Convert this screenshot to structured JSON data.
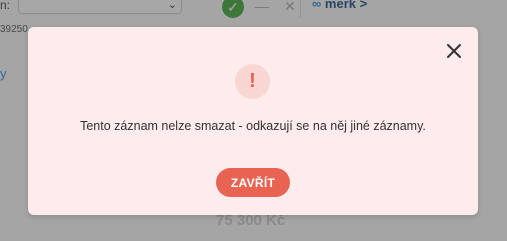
{
  "background": {
    "field_label": "n:",
    "number_fragment": "39250",
    "merk_label": "merk",
    "merk_arrow": ">",
    "side_letter": "y",
    "price": "75 300 Kč",
    "check_icon": "check-icon",
    "minus_icon": "minus-icon",
    "x_icon": "close-icon"
  },
  "dialog": {
    "icon": "warning-icon",
    "icon_glyph": "!",
    "message": "Tento záznam nelze smazat - odkazují se na něj jiné záznamy.",
    "close_button_label": "ZAVŘÍT",
    "accent_color": "#e96353",
    "background_color": "#fdeceb"
  }
}
